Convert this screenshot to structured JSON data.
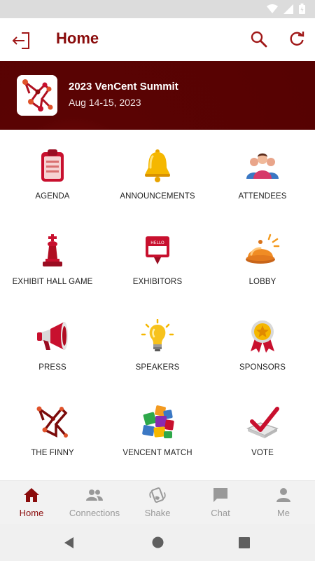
{
  "app": {
    "title": "Home"
  },
  "header": {
    "icons": [
      "exit-icon",
      "search-icon",
      "refresh-icon"
    ]
  },
  "event": {
    "name": "2023 VenCent Summit",
    "dates": "Aug 14-15, 2023"
  },
  "tiles": [
    {
      "label": "AGENDA",
      "icon": "clipboard-icon"
    },
    {
      "label": "ANNOUNCEMENTS",
      "icon": "bell-icon"
    },
    {
      "label": "ATTENDEES",
      "icon": "people-icon"
    },
    {
      "label": "EXHIBIT HALL GAME",
      "icon": "chess-king-icon"
    },
    {
      "label": "EXHIBITORS",
      "icon": "name-tag-sign-icon"
    },
    {
      "label": "LOBBY",
      "icon": "service-bell-icon"
    },
    {
      "label": "PRESS",
      "icon": "megaphone-icon"
    },
    {
      "label": "SPEAKERS",
      "icon": "lightbulb-icon"
    },
    {
      "label": "SPONSORS",
      "icon": "award-medal-icon"
    },
    {
      "label": "THE FINNY",
      "icon": "finny-logo-icon"
    },
    {
      "label": "VENCENT MATCH",
      "icon": "puzzle-pieces-icon"
    },
    {
      "label": "VOTE",
      "icon": "checkbox-vote-icon"
    }
  ],
  "bottom_nav": [
    {
      "label": "Home",
      "icon": "home-icon",
      "active": true
    },
    {
      "label": "Connections",
      "icon": "connections-icon",
      "active": false
    },
    {
      "label": "Shake",
      "icon": "shake-phone-icon",
      "active": false
    },
    {
      "label": "Chat",
      "icon": "chat-icon",
      "active": false
    },
    {
      "label": "Me",
      "icon": "person-icon",
      "active": false
    }
  ],
  "colors": {
    "brand": "#8a0c0c",
    "banner": "#560202",
    "inactive": "#999999"
  }
}
